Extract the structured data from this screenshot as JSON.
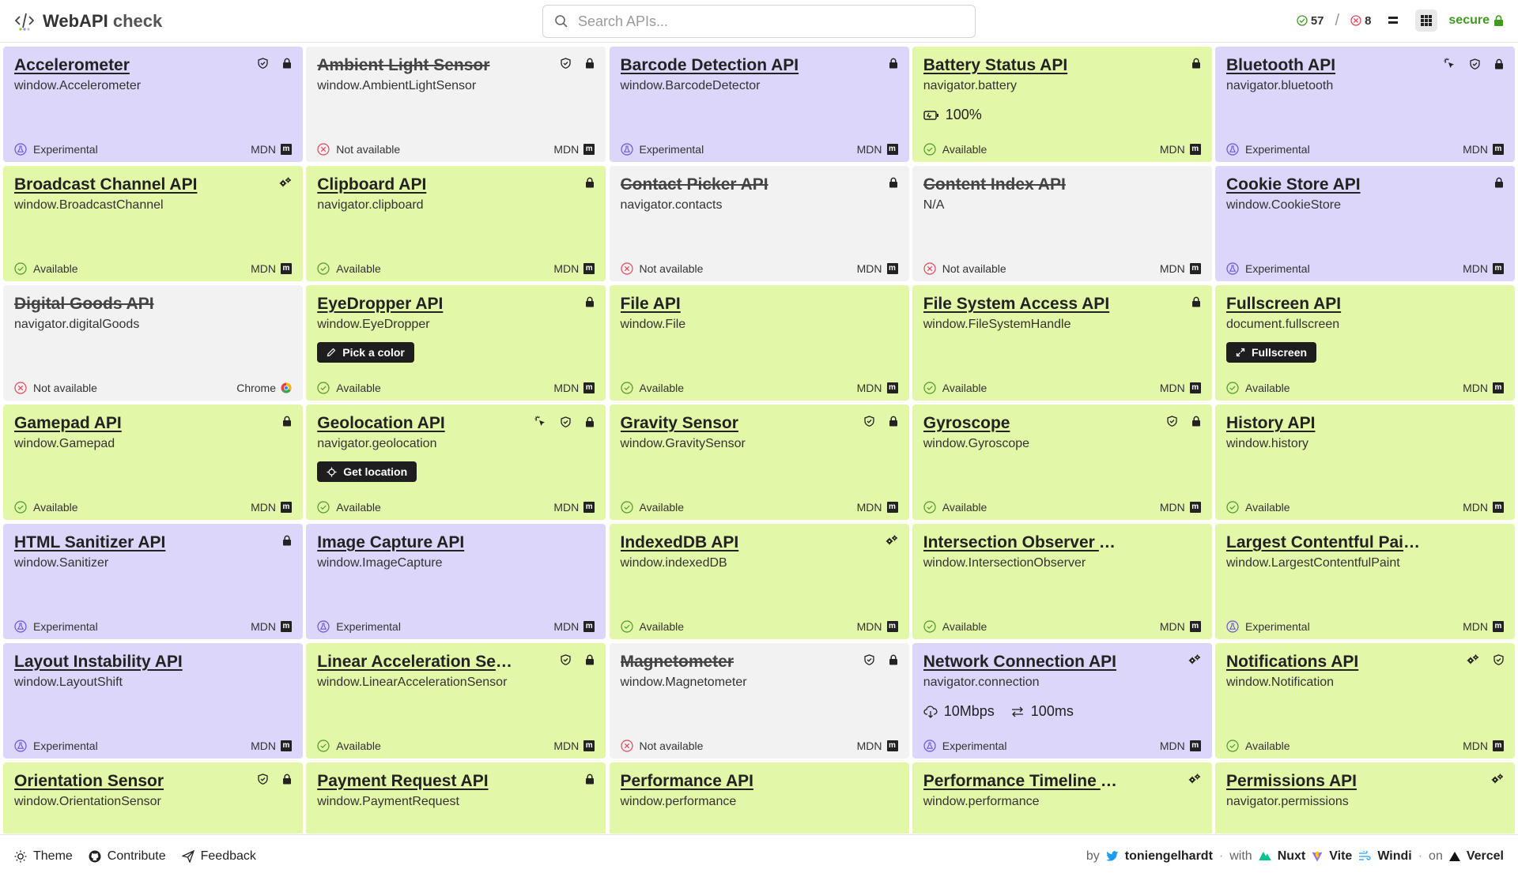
{
  "app": {
    "title_prefix": "WebAPI",
    "title_suffix": " check"
  },
  "search": {
    "placeholder": "Search APIs..."
  },
  "header": {
    "available_count": "57",
    "unavailable_count": "8",
    "secure_label": "secure"
  },
  "colors": {
    "available": "#e3f7a8",
    "experimental": "#dcd6fa",
    "unavailable": "#f2f2f2",
    "secure": "#3f9a1f",
    "unavailable_icon": "#e0485a"
  },
  "cards": [
    {
      "title": "Accelerometer",
      "path": "window.Accelerometer",
      "status": "Experimental",
      "state": "experimental",
      "link": "MDN",
      "icons": [
        "shield-icon",
        "lock-icon"
      ]
    },
    {
      "title": "Ambient Light Sensor",
      "path": "window.AmbientLightSensor",
      "status": "Not available",
      "state": "unavailable",
      "link": "MDN",
      "icons": [
        "shield-icon",
        "lock-icon"
      ]
    },
    {
      "title": "Barcode Detection API",
      "path": "window.BarcodeDetector",
      "status": "Experimental",
      "state": "experimental",
      "link": "MDN",
      "icons": [
        "lock-icon"
      ]
    },
    {
      "title": "Battery Status API",
      "path": "navigator.battery",
      "status": "Available",
      "state": "available",
      "link": "MDN",
      "icons": [
        "lock-icon"
      ],
      "extra": {
        "type": "battery",
        "text": "100%"
      }
    },
    {
      "title": "Bluetooth API",
      "path": "navigator.bluetooth",
      "status": "Experimental",
      "state": "experimental",
      "link": "MDN",
      "icons": [
        "pointer-icon",
        "shield-icon",
        "lock-icon"
      ]
    },
    {
      "title": "Broadcast Channel API",
      "path": "window.BroadcastChannel",
      "status": "Available",
      "state": "available",
      "link": "MDN",
      "icons": [
        "gears-icon"
      ]
    },
    {
      "title": "Clipboard API",
      "path": "navigator.clipboard",
      "status": "Available",
      "state": "available",
      "link": "MDN",
      "icons": [
        "lock-icon"
      ]
    },
    {
      "title": "Contact Picker API",
      "path": "navigator.contacts",
      "status": "Not available",
      "state": "unavailable",
      "link": "MDN",
      "icons": [
        "lock-icon"
      ]
    },
    {
      "title": "Content Index API",
      "path": "N/A",
      "status": "Not available",
      "state": "unavailable",
      "link": "MDN",
      "icons": []
    },
    {
      "title": "Cookie Store API",
      "path": "window.CookieStore",
      "status": "Experimental",
      "state": "experimental",
      "link": "MDN",
      "icons": [
        "lock-icon"
      ]
    },
    {
      "title": "Digital Goods API",
      "path": "navigator.digitalGoods",
      "status": "Not available",
      "state": "unavailable",
      "link": "Chrome",
      "icons": []
    },
    {
      "title": "EyeDropper API",
      "path": "window.EyeDropper",
      "status": "Available",
      "state": "available",
      "link": "MDN",
      "icons": [
        "lock-icon"
      ],
      "button": {
        "icon": "pen-icon",
        "label": "Pick a color"
      }
    },
    {
      "title": "File API",
      "path": "window.File",
      "status": "Available",
      "state": "available",
      "link": "MDN",
      "icons": []
    },
    {
      "title": "File System Access API",
      "path": "window.FileSystemHandle",
      "status": "Available",
      "state": "available",
      "link": "MDN",
      "icons": [
        "lock-icon"
      ]
    },
    {
      "title": "Fullscreen API",
      "path": "document.fullscreen",
      "status": "Available",
      "state": "available",
      "link": "MDN",
      "icons": [],
      "button": {
        "icon": "expand-icon",
        "label": "Fullscreen"
      }
    },
    {
      "title": "Gamepad API",
      "path": "window.Gamepad",
      "status": "Available",
      "state": "available",
      "link": "MDN",
      "icons": [
        "lock-icon"
      ]
    },
    {
      "title": "Geolocation API",
      "path": "navigator.geolocation",
      "status": "Available",
      "state": "available",
      "link": "MDN",
      "icons": [
        "pointer-icon",
        "shield-icon",
        "lock-icon"
      ],
      "button": {
        "icon": "crosshair-icon",
        "label": "Get location"
      }
    },
    {
      "title": "Gravity Sensor",
      "path": "window.GravitySensor",
      "status": "Available",
      "state": "available",
      "link": "MDN",
      "icons": [
        "shield-icon",
        "lock-icon"
      ]
    },
    {
      "title": "Gyroscope",
      "path": "window.Gyroscope",
      "status": "Available",
      "state": "available",
      "link": "MDN",
      "icons": [
        "shield-icon",
        "lock-icon"
      ]
    },
    {
      "title": "History API",
      "path": "window.history",
      "status": "Available",
      "state": "available",
      "link": "MDN",
      "icons": []
    },
    {
      "title": "HTML Sanitizer API",
      "path": "window.Sanitizer",
      "status": "Experimental",
      "state": "experimental",
      "link": "MDN",
      "icons": [
        "lock-icon"
      ]
    },
    {
      "title": "Image Capture API",
      "path": "window.ImageCapture",
      "status": "Experimental",
      "state": "experimental",
      "link": "MDN",
      "icons": []
    },
    {
      "title": "IndexedDB API",
      "path": "window.indexedDB",
      "status": "Available",
      "state": "available",
      "link": "MDN",
      "icons": [
        "gears-icon"
      ]
    },
    {
      "title": "Intersection Observer API",
      "path": "window.IntersectionObserver",
      "status": "Available",
      "state": "available",
      "link": "MDN",
      "icons": []
    },
    {
      "title": "Largest Contentful Paint API",
      "path": "window.LargestContentfulPaint",
      "status": "Experimental",
      "state": "available",
      "link": "MDN",
      "icons": []
    },
    {
      "title": "Layout Instability API",
      "path": "window.LayoutShift",
      "status": "Experimental",
      "state": "experimental",
      "link": "MDN",
      "icons": []
    },
    {
      "title": "Linear Acceleration Sen...",
      "path": "window.LinearAccelerationSensor",
      "status": "Available",
      "state": "available",
      "link": "MDN",
      "icons": [
        "shield-icon",
        "lock-icon"
      ]
    },
    {
      "title": "Magnetometer",
      "path": "window.Magnetometer",
      "status": "Not available",
      "state": "unavailable",
      "link": "MDN",
      "icons": [
        "shield-icon",
        "lock-icon"
      ]
    },
    {
      "title": "Network Connection API",
      "path": "navigator.connection",
      "status": "Experimental",
      "state": "experimental",
      "link": "MDN",
      "icons": [
        "gears-icon"
      ],
      "extra": {
        "type": "network",
        "text": "10Mbps",
        "text2": "100ms"
      }
    },
    {
      "title": "Notifications API",
      "path": "window.Notification",
      "status": "Available",
      "state": "available",
      "link": "MDN",
      "icons": [
        "gears-icon",
        "shield-icon"
      ]
    },
    {
      "title": "Orientation Sensor",
      "path": "window.OrientationSensor",
      "status": "",
      "state": "available",
      "link": "",
      "icons": [
        "shield-icon",
        "lock-icon"
      ]
    },
    {
      "title": "Payment Request API",
      "path": "window.PaymentRequest",
      "status": "",
      "state": "available",
      "link": "",
      "icons": [
        "lock-icon"
      ]
    },
    {
      "title": "Performance API",
      "path": "window.performance",
      "status": "",
      "state": "available",
      "link": "",
      "icons": []
    },
    {
      "title": "Performance Timeline API",
      "path": "window.performance",
      "status": "",
      "state": "available",
      "link": "",
      "icons": [
        "gears-icon"
      ]
    },
    {
      "title": "Permissions API",
      "path": "navigator.permissions",
      "status": "",
      "state": "available",
      "link": "",
      "icons": [
        "gears-icon"
      ]
    }
  ],
  "footer": {
    "theme": "Theme",
    "contribute": "Contribute",
    "feedback": "Feedback",
    "by": "by",
    "author": "toniengelhardt",
    "with": "with",
    "tech1": "Nuxt",
    "tech2": "Vite",
    "tech3": "Windi",
    "on": "on",
    "host": "Vercel"
  }
}
